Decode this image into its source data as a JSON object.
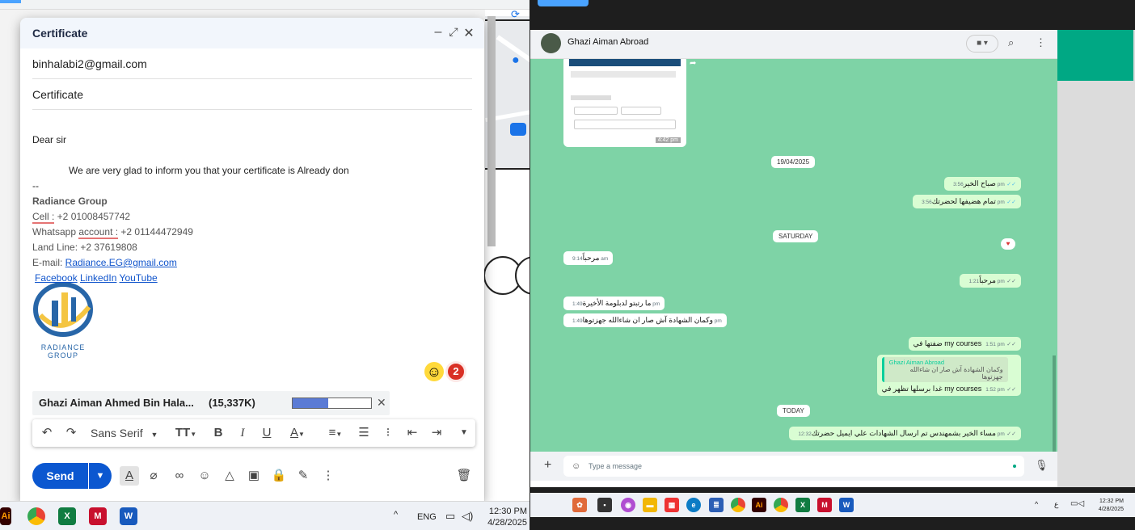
{
  "gmail": {
    "title": "Certificate",
    "to": "binhalabi2@gmail.com",
    "subject": "Certificate",
    "body": {
      "greeting": "Dear sir",
      "line": "We are very glad to inform you that your certificate is Already don",
      "sep": "--",
      "company": "Radiance Group",
      "cell_label": "Cell :",
      "cell_value": " +2 01008457742",
      "whatsapp_label_a": "Whatsapp ",
      "whatsapp_label_b": "account :",
      "whatsapp_value": " +2 01144472949",
      "landline": "Land Line: +2 37619808",
      "email_label": "E-mail: ",
      "email_value": "Radiance.EG@gmail.com",
      "facebook": "Facebook",
      "linkedin": "LinkedIn",
      "youtube": "YouTube "
    },
    "logo_text": [
      "RADIANCE",
      "GROUP"
    ],
    "badge_count": "2",
    "attachment": {
      "name": "Ghazi Aiman Ahmed Bin Hala...",
      "size": "(15,337K)",
      "progress": 0.45
    },
    "toolbar": {
      "font": "Sans Serif"
    },
    "send_label": "Send"
  },
  "taskbar_left": {
    "lang": "ENG",
    "time": "12:30 PM",
    "date": "4/28/2025"
  },
  "whatsapp": {
    "contact": "Ghazi Aiman Abroad",
    "thumb_time": "4:42 pm",
    "date_chip_1": "19/04/2025",
    "date_chip_2": "SATURDAY",
    "date_chip_3": "TODAY",
    "messages": [
      {
        "text": "صباح الخير",
        "time": "3:56 pm"
      },
      {
        "text": "تمام هضيفها لحضرتك",
        "time": "3:56 pm"
      },
      {
        "text": "مرحباً",
        "time": "9:14 am"
      },
      {
        "text": "مرحباً",
        "time": "1:21 pm"
      },
      {
        "text": "ما رتبتو لدبلومة الأخيرة",
        "time": "1:49 pm"
      },
      {
        "text": "وكمان الشهادة آش صار ان شاءالله جهزتوها",
        "time": "1:49 pm"
      },
      {
        "text": "ضفتها في my courses",
        "time": "1:51 pm"
      },
      {
        "text": "غدا برسلها تظهر في my courses",
        "time": "1:52 pm"
      },
      {
        "text": "مساء الخير بشمهندس تم ارسال الشهادات علي ايميل حضرتك",
        "time": "12:32 pm"
      }
    ],
    "quote_name": "Ghazi Aiman Abroad",
    "quote_text": "وكمان الشهادة آش صار ان شاءالله جهزتوها",
    "input_placeholder": "Type a message"
  },
  "taskbar_right": {
    "lang": "ع",
    "time": "12:32 PM",
    "date": "4/28/2025"
  }
}
